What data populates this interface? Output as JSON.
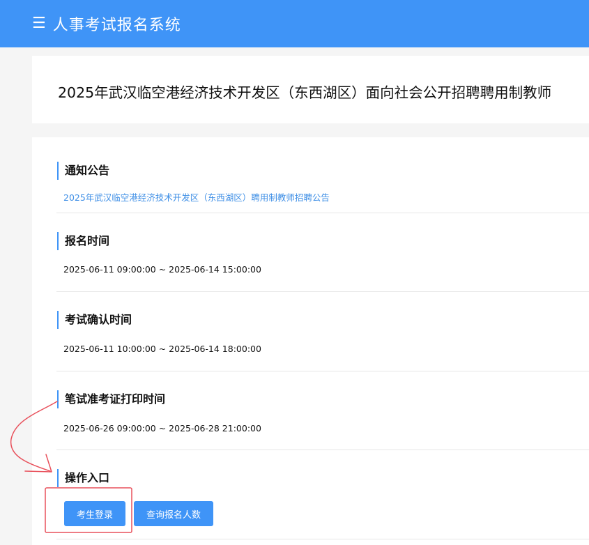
{
  "header": {
    "menu_icon": "☰",
    "title": "人事考试报名系统"
  },
  "page_title": "2025年武汉临空港经济技术开发区（东西湖区）面向社会公开招聘聘用制教师",
  "sections": {
    "notice": {
      "heading": "通知公告",
      "link_text": "2025年武汉临空港经济技术开发区（东西湖区）聘用制教师招聘公告"
    },
    "registration": {
      "heading": "报名时间",
      "value": "2025-06-11 09:00:00 ~ 2025-06-14 15:00:00"
    },
    "confirmation": {
      "heading": "考试确认时间",
      "value": "2025-06-11 10:00:00 ~ 2025-06-14 18:00:00"
    },
    "admission_print": {
      "heading": "笔试准考证打印时间",
      "value": "2025-06-26 09:00:00 ~ 2025-06-28 21:00:00"
    },
    "operations": {
      "heading": "操作入口",
      "login_button": "考生登录",
      "count_button": "查询报名人数"
    }
  },
  "colors": {
    "accent": "#3f94f7",
    "link": "#3f8fe6",
    "annotation": "#e8505b"
  },
  "icons": {
    "menu": "menu-icon"
  }
}
